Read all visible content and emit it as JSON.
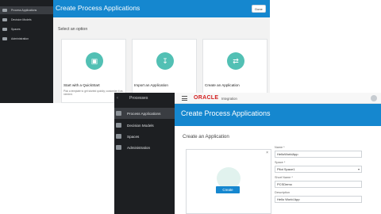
{
  "back_window": {
    "sidebar": {
      "items": [
        {
          "label": "Process Applications",
          "active": true,
          "icon": "apps-icon"
        },
        {
          "label": "Decision Models",
          "active": false,
          "icon": "grid-icon"
        },
        {
          "label": "Spaces",
          "active": false,
          "icon": "folder-icon"
        },
        {
          "label": "Administration",
          "active": false,
          "icon": "gear-icon"
        }
      ]
    },
    "title": "Create Process Applications",
    "done_label": "Done",
    "subheading": "Select an option",
    "cards": [
      {
        "title": "Start with a QuickStart",
        "desc": "Pick a template to get started quickly; customize it as needed.",
        "icon": "monitor-icon"
      },
      {
        "title": "Import an Application",
        "desc": "",
        "icon": "download-icon"
      },
      {
        "title": "Create an Application",
        "desc": "",
        "icon": "share-icon"
      }
    ]
  },
  "front_window": {
    "brand_label": "Processes",
    "sidebar": {
      "items": [
        {
          "label": "Process Applications",
          "active": true,
          "icon": "apps-icon"
        },
        {
          "label": "Decision Models",
          "active": false,
          "icon": "grid-icon"
        },
        {
          "label": "Spaces",
          "active": false,
          "icon": "folder-icon"
        },
        {
          "label": "Administration",
          "active": false,
          "icon": "gear-icon"
        }
      ]
    },
    "logo": "ORACLE",
    "logo_sub": "Integration",
    "header_title": "Create Process Applications",
    "subheading": "Create an Application",
    "create_label": "Create",
    "form": {
      "fields": [
        {
          "label": "Name *",
          "value": "HelloWorldApp"
        },
        {
          "label": "Space *",
          "value": "Pilot Space1",
          "dropdown": true
        },
        {
          "label": "Short Name *",
          "value": "PCSDemo"
        },
        {
          "label": "Description",
          "value": "Hello World App"
        }
      ]
    }
  },
  "colors": {
    "accent_blue": "#1587cf",
    "sidebar_dark": "#1d1f22",
    "teal": "#52c0b4",
    "oracle_red": "#d21d1d"
  }
}
